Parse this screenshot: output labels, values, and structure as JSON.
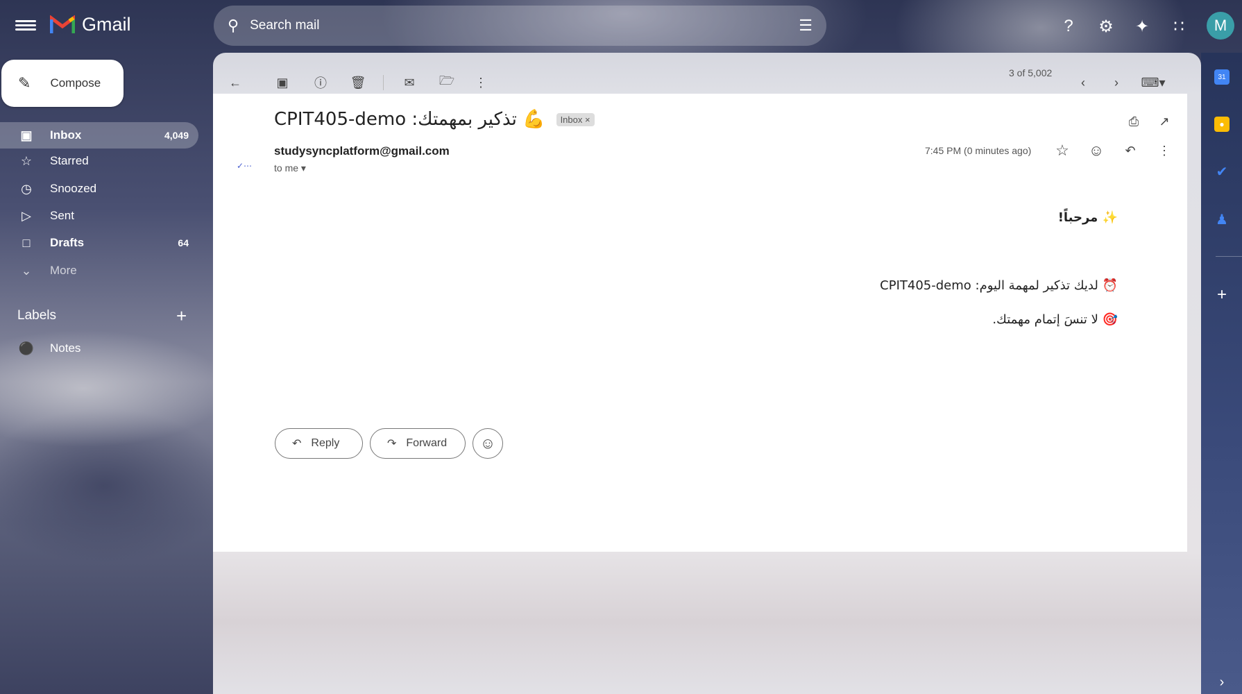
{
  "header": {
    "app_name": "Gmail",
    "search_placeholder": "Search mail",
    "avatar_letter": "M"
  },
  "sidebar": {
    "compose": "Compose",
    "items": [
      {
        "label": "Inbox",
        "count": "4,049",
        "icon": "inbox-icon"
      },
      {
        "label": "Starred",
        "count": "",
        "icon": "star-icon"
      },
      {
        "label": "Snoozed",
        "count": "",
        "icon": "clock-icon"
      },
      {
        "label": "Sent",
        "count": "",
        "icon": "send-icon"
      },
      {
        "label": "Drafts",
        "count": "64",
        "icon": "draft-icon"
      },
      {
        "label": "More",
        "count": "",
        "icon": "chevron-down-icon"
      }
    ],
    "labels_heading": "Labels",
    "labels": [
      {
        "label": "Notes"
      }
    ]
  },
  "toolbar": {
    "pagination": "3 of 5,002"
  },
  "email": {
    "subject": "CPIT405-demo :تذكير بمهمتك 💪",
    "label_chip": "Inbox",
    "sender": "studysyncplatform@gmail.com",
    "recipient": "to me",
    "time": "7:45 PM (0 minutes ago)",
    "body": [
      "✨ مرحباً!",
      "⏰ لديك تذكير لمهمة اليوم: CPIT405-demo",
      "🎯 لا تنسَ إتمام مهمتك."
    ]
  },
  "actions": {
    "reply": "Reply",
    "forward": "Forward"
  },
  "colors": {
    "accent": "#3a9ea8"
  }
}
